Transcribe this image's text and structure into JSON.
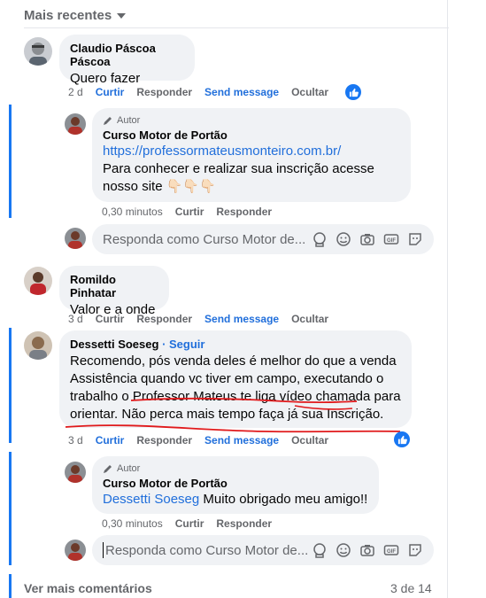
{
  "header": {
    "title": "Mais recentes"
  },
  "comments": [
    {
      "author": "Claudio Páscoa Páscoa",
      "text": "Quero fazer",
      "time": "2 d",
      "actions": {
        "like": "Curtir",
        "reply": "Responder",
        "send": "Send message",
        "hide": "Ocultar"
      },
      "reply": {
        "author_badge": "Autor",
        "author": "Curso Motor de Portão",
        "url": "https://professormateusmonteiro.com.br/",
        "text": "Para conhecer e realizar sua inscrição acesse nosso site 👇🏻👇🏻👇🏻",
        "time": "0,30 minutos",
        "like": "Curtir",
        "reply": "Responder"
      },
      "reply_placeholder": "Responda como Curso Motor de..."
    },
    {
      "author": "Romildo Pinhatar",
      "text": "Valor e a onde",
      "time": "3 d",
      "actions": {
        "like": "Curtir",
        "reply": "Responder",
        "send": "Send message",
        "hide": "Ocultar"
      }
    },
    {
      "author": "Dessetti Soeseg",
      "follow": "· Seguir",
      "text": "Recomendo, pós venda deles é melhor do que a venda Assistência quando vc tiver em campo, executando o trabalho o Professor Mateus te liga vídeo chamada para orientar. Não perca mais tempo faça já sua Inscrição.",
      "time": "3 d",
      "actions": {
        "like": "Curtir",
        "reply": "Responder",
        "send": "Send message",
        "hide": "Ocultar"
      },
      "reply": {
        "author_badge": "Autor",
        "author": "Curso Motor de Portão",
        "mention": "Dessetti Soeseg",
        "text": " Muito obrigado meu amigo!!",
        "time": "0,30 minutos",
        "like": "Curtir",
        "reply": "Responder"
      },
      "reply_placeholder": "Responda como Curso Motor de..."
    }
  ],
  "footer": {
    "more": "Ver mais comentários",
    "count": "3 de 14"
  },
  "colors": {
    "link": "#216fdb",
    "accent": "#1877f2",
    "bubble": "#f0f2f5",
    "annotation": "#e0191b"
  }
}
